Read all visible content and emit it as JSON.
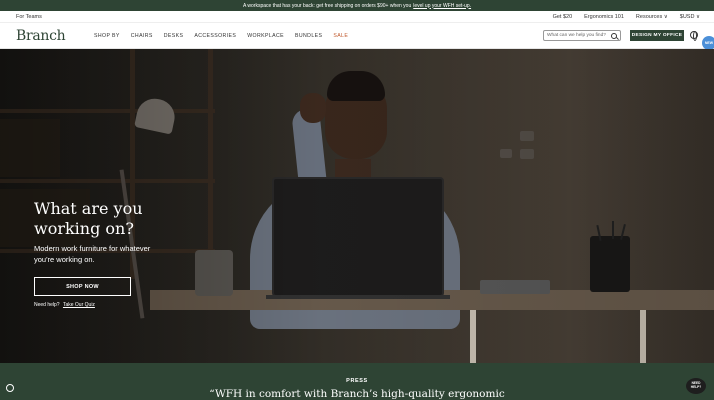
{
  "promo": {
    "text": "A workspace that has your back: get free shipping on orders $90+ when you",
    "link": "level up your WFH set-up."
  },
  "utility": {
    "left": "For Teams",
    "items": [
      "Get $20",
      "Ergonomics 101",
      "Resources ∨",
      "$USD ∨"
    ]
  },
  "nav": {
    "logo": "Branch",
    "menu": [
      "SHOP BY",
      "CHAIRS",
      "DESKS",
      "ACCESSORIES",
      "WORKPLACE",
      "BUNDLES",
      "SALE"
    ],
    "search_placeholder": "What can we help you find?",
    "design_button": "DESIGN MY OFFICE",
    "side_badge": "NEW"
  },
  "hero": {
    "title": "What are you working on?",
    "subtitle": "Modern work furniture for whatever you're working on.",
    "cta": "SHOP NOW",
    "help_text": "Need help?",
    "help_link": "Take Our Quiz"
  },
  "press": {
    "label": "PRESS",
    "quote": "“WFH in comfort with Branch’s high-quality ergonomic",
    "help_bubble": "NEED HELP?"
  },
  "colors": {
    "brand_green": "#2e4434",
    "sale": "#c0592c"
  }
}
